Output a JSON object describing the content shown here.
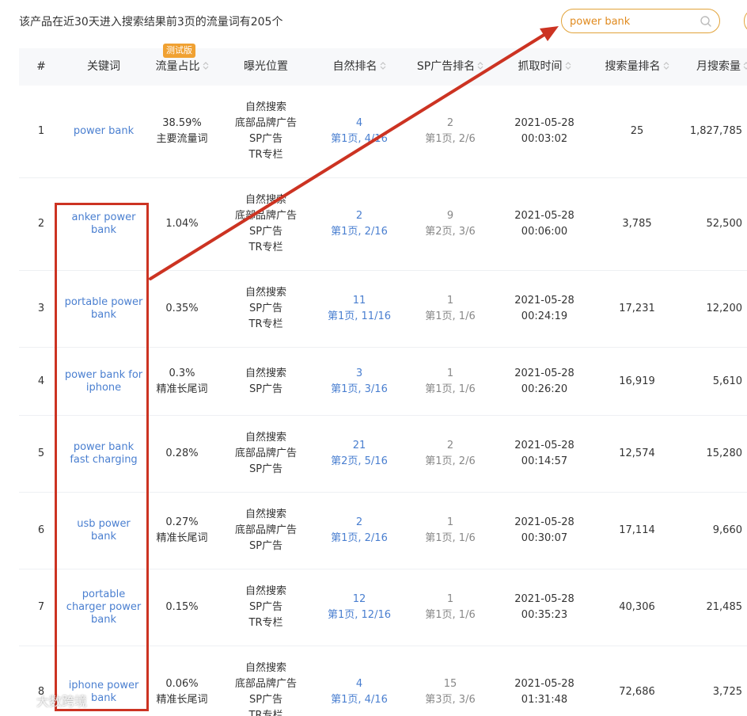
{
  "summary": "该产品在近30天进入搜索结果前3页的流量词有205个",
  "search": {
    "value": "power bank"
  },
  "badge": "测试版",
  "columns": {
    "idx": "#",
    "keyword": "关键词",
    "flow": "流量占比",
    "exposure": "曝光位置",
    "natural": "自然排名",
    "sp": "SP广告排名",
    "time": "抓取时间",
    "search_rank": "搜索量排名",
    "monthly": "月搜索量"
  },
  "rows": [
    {
      "idx": "1",
      "keyword": "power bank",
      "flow": "38.59%",
      "flow_tag": "主要流量词",
      "exposure": [
        "自然搜索",
        "底部品牌广告",
        "SP广告",
        "TR专栏"
      ],
      "natural_rank": "4",
      "natural_page": "第1页, 4/16",
      "sp_rank": "2",
      "sp_page": "第1页, 2/6",
      "date": "2021-05-28",
      "time": "00:03:02",
      "search_rank": "25",
      "monthly": "1,827,785"
    },
    {
      "idx": "2",
      "keyword": "anker power bank",
      "flow": "1.04%",
      "flow_tag": "",
      "exposure": [
        "自然搜索",
        "底部品牌广告",
        "SP广告",
        "TR专栏"
      ],
      "natural_rank": "2",
      "natural_page": "第1页, 2/16",
      "sp_rank": "9",
      "sp_page": "第2页, 3/6",
      "date": "2021-05-28",
      "time": "00:06:00",
      "search_rank": "3,785",
      "monthly": "52,500"
    },
    {
      "idx": "3",
      "keyword": "portable power bank",
      "flow": "0.35%",
      "flow_tag": "",
      "exposure": [
        "自然搜索",
        "SP广告",
        "TR专栏"
      ],
      "natural_rank": "11",
      "natural_page": "第1页, 11/16",
      "sp_rank": "1",
      "sp_page": "第1页, 1/6",
      "date": "2021-05-28",
      "time": "00:24:19",
      "search_rank": "17,231",
      "monthly": "12,200"
    },
    {
      "idx": "4",
      "keyword": "power bank for iphone",
      "flow": "0.3%",
      "flow_tag": "精准长尾词",
      "exposure": [
        "自然搜索",
        "SP广告"
      ],
      "natural_rank": "3",
      "natural_page": "第1页, 3/16",
      "sp_rank": "1",
      "sp_page": "第1页, 1/6",
      "date": "2021-05-28",
      "time": "00:26:20",
      "search_rank": "16,919",
      "monthly": "5,610"
    },
    {
      "idx": "5",
      "keyword": "power bank fast charging",
      "flow": "0.28%",
      "flow_tag": "",
      "exposure": [
        "自然搜索",
        "底部品牌广告",
        "SP广告"
      ],
      "natural_rank": "21",
      "natural_page": "第2页, 5/16",
      "sp_rank": "2",
      "sp_page": "第1页, 2/6",
      "date": "2021-05-28",
      "time": "00:14:57",
      "search_rank": "12,574",
      "monthly": "15,280"
    },
    {
      "idx": "6",
      "keyword": "usb power bank",
      "flow": "0.27%",
      "flow_tag": "精准长尾词",
      "exposure": [
        "自然搜索",
        "底部品牌广告",
        "SP广告"
      ],
      "natural_rank": "2",
      "natural_page": "第1页, 2/16",
      "sp_rank": "1",
      "sp_page": "第1页, 1/6",
      "date": "2021-05-28",
      "time": "00:30:07",
      "search_rank": "17,114",
      "monthly": "9,660"
    },
    {
      "idx": "7",
      "keyword": "portable charger power bank",
      "flow": "0.15%",
      "flow_tag": "",
      "exposure": [
        "自然搜索",
        "SP广告",
        "TR专栏"
      ],
      "natural_rank": "12",
      "natural_page": "第1页, 12/16",
      "sp_rank": "1",
      "sp_page": "第1页, 1/6",
      "date": "2021-05-28",
      "time": "00:35:23",
      "search_rank": "40,306",
      "monthly": "21,485"
    },
    {
      "idx": "8",
      "keyword": "iphone power bank",
      "flow": "0.06%",
      "flow_tag": "精准长尾词",
      "exposure": [
        "自然搜索",
        "底部品牌广告",
        "SP广告",
        "TR专栏"
      ],
      "natural_rank": "4",
      "natural_page": "第1页, 4/16",
      "sp_rank": "15",
      "sp_page": "第3页, 3/6",
      "date": "2021-05-28",
      "time": "01:31:48",
      "search_rank": "72,686",
      "monthly": "3,725"
    }
  ],
  "watermark": "大数跨境",
  "colors": {
    "accent": "#e2a33a",
    "link": "#4a7fd0",
    "annotation": "#cc3322",
    "header_bg": "#f7f8fa"
  },
  "icons": {
    "search": "search-icon",
    "sort": "sort-icon",
    "watermark": "logo-icon"
  }
}
